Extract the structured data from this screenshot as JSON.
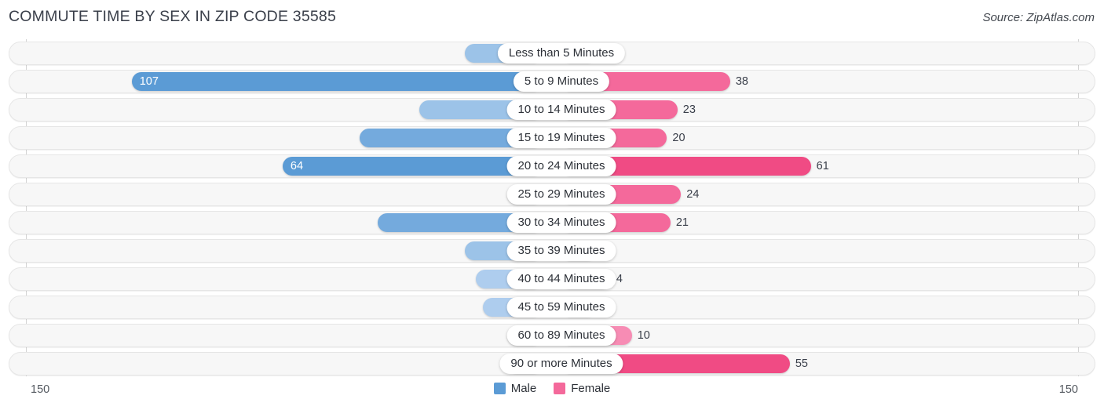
{
  "header": {
    "title": "COMMUTE TIME BY SEX IN ZIP CODE 35585",
    "source": "Source: ZipAtlas.com"
  },
  "axis": {
    "left_label": "150",
    "right_label": "150"
  },
  "legend": {
    "items": [
      {
        "label": "Male",
        "color": "#5b9bd5"
      },
      {
        "label": "Female",
        "color": "#f4699b"
      }
    ]
  },
  "chart_data": {
    "type": "bar",
    "title": "COMMUTE TIME BY SEX IN ZIP CODE 35585",
    "subtitle": "Source: ZipAtlas.com",
    "orientation": "horizontal-diverging",
    "xlabel": "",
    "ylabel": "",
    "xlim": [
      150,
      150
    ],
    "grid": false,
    "legend_position": "bottom-center",
    "categories": [
      "Less than 5 Minutes",
      "5 to 9 Minutes",
      "10 to 14 Minutes",
      "15 to 19 Minutes",
      "20 to 24 Minutes",
      "25 to 29 Minutes",
      "30 to 34 Minutes",
      "35 to 39 Minutes",
      "40 to 44 Minutes",
      "45 to 59 Minutes",
      "60 to 89 Minutes",
      "90 or more Minutes"
    ],
    "series": [
      {
        "name": "Male",
        "color": "#5b9bd5",
        "values": [
          12,
          107,
          25,
          42,
          64,
          0,
          37,
          12,
          9,
          7,
          0,
          0
        ]
      },
      {
        "name": "Female",
        "color": "#f4699b",
        "values": [
          0,
          38,
          23,
          20,
          61,
          24,
          21,
          0,
          4,
          0,
          10,
          55
        ]
      }
    ]
  },
  "rows": [
    {
      "label": "Less than 5 Minutes",
      "male": "12",
      "female": "0"
    },
    {
      "label": "5 to 9 Minutes",
      "male": "107",
      "female": "38"
    },
    {
      "label": "10 to 14 Minutes",
      "male": "25",
      "female": "23"
    },
    {
      "label": "15 to 19 Minutes",
      "male": "42",
      "female": "20"
    },
    {
      "label": "20 to 24 Minutes",
      "male": "64",
      "female": "61"
    },
    {
      "label": "25 to 29 Minutes",
      "male": "0",
      "female": "24"
    },
    {
      "label": "30 to 34 Minutes",
      "male": "37",
      "female": "21"
    },
    {
      "label": "35 to 39 Minutes",
      "male": "12",
      "female": "0"
    },
    {
      "label": "40 to 44 Minutes",
      "male": "9",
      "female": "4"
    },
    {
      "label": "45 to 59 Minutes",
      "male": "7",
      "female": "0"
    },
    {
      "label": "60 to 89 Minutes",
      "male": "0",
      "female": "10"
    },
    {
      "label": "90 or more Minutes",
      "male": "0",
      "female": "55"
    }
  ]
}
